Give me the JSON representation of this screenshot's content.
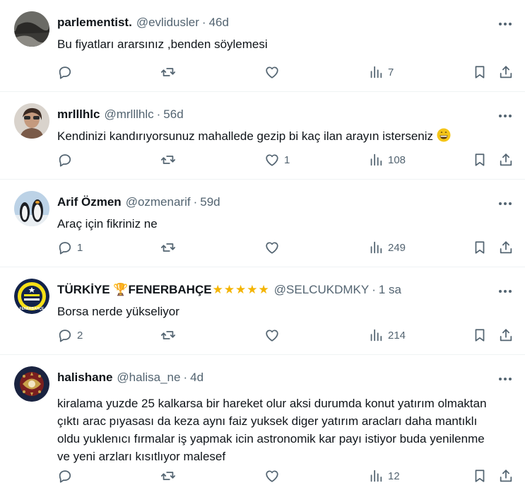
{
  "tweets": [
    {
      "name": "parlementist.",
      "handle": "@evlidusler",
      "dot": "·",
      "time": "46d",
      "text": "Bu fiyatları ararsınız ,benden söylemesi",
      "reply_count": "",
      "retweet_count": "",
      "like_count": "",
      "view_count": "7",
      "avatar": "photo-avatar"
    },
    {
      "name": "mrlllhlc",
      "handle": "@mrlllhlc",
      "dot": "·",
      "time": "56d",
      "text": "Kendinizi kandırıyorsunuz mahallede gezip bi kaç ilan arayın isterseniz",
      "reply_count": "",
      "retweet_count": "",
      "like_count": "1",
      "view_count": "108",
      "avatar": "photo-avatar"
    },
    {
      "name": "Arif Özmen",
      "handle": "@ozmenarif",
      "dot": "·",
      "time": "59d",
      "text": "Araç için fikriniz ne",
      "reply_count": "1",
      "retweet_count": "",
      "like_count": "",
      "view_count": "249",
      "avatar": "penguins-avatar"
    },
    {
      "name": "TÜRKİYE 🏆FENERBAHÇE",
      "name_stars": "★★★★★",
      "handle": "@SELCUKDMKY",
      "dot": "·",
      "time": "1 sa",
      "text": "Borsa nerde yükseliyor",
      "reply_count": "2",
      "retweet_count": "",
      "like_count": "",
      "view_count": "214",
      "avatar": "fenerbahce-logo-avatar",
      "logo_text": "FENERBAHÇE"
    },
    {
      "name": "halishane",
      "handle": "@halisa_ne",
      "dot": "·",
      "time": "4d",
      "text": "kiralama yuzde 25 kalkarsa bir hareket olur aksi durumda konut yatırım olmaktan çıktı arac pıyasası da keza aynı faiz yuksek diger yatırım aracları daha mantıklı oldu yuklenıcı fırmalar iş yapmak icin astronomik kar payı istiyor buda yenilenme ve yeni arzları kısıtlıyor malesef",
      "reply_count": "",
      "retweet_count": "",
      "like_count": "",
      "view_count": "12",
      "avatar": "emblem-avatar"
    }
  ],
  "colors": {
    "text": "#0f1419",
    "secondary": "#536471",
    "border": "#eff3f4",
    "stars": "#f4b400"
  },
  "icons": [
    "reply-icon",
    "retweet-icon",
    "like-icon",
    "views-icon",
    "bookmark-icon",
    "share-icon",
    "more-icon",
    "grinning-emoji"
  ]
}
